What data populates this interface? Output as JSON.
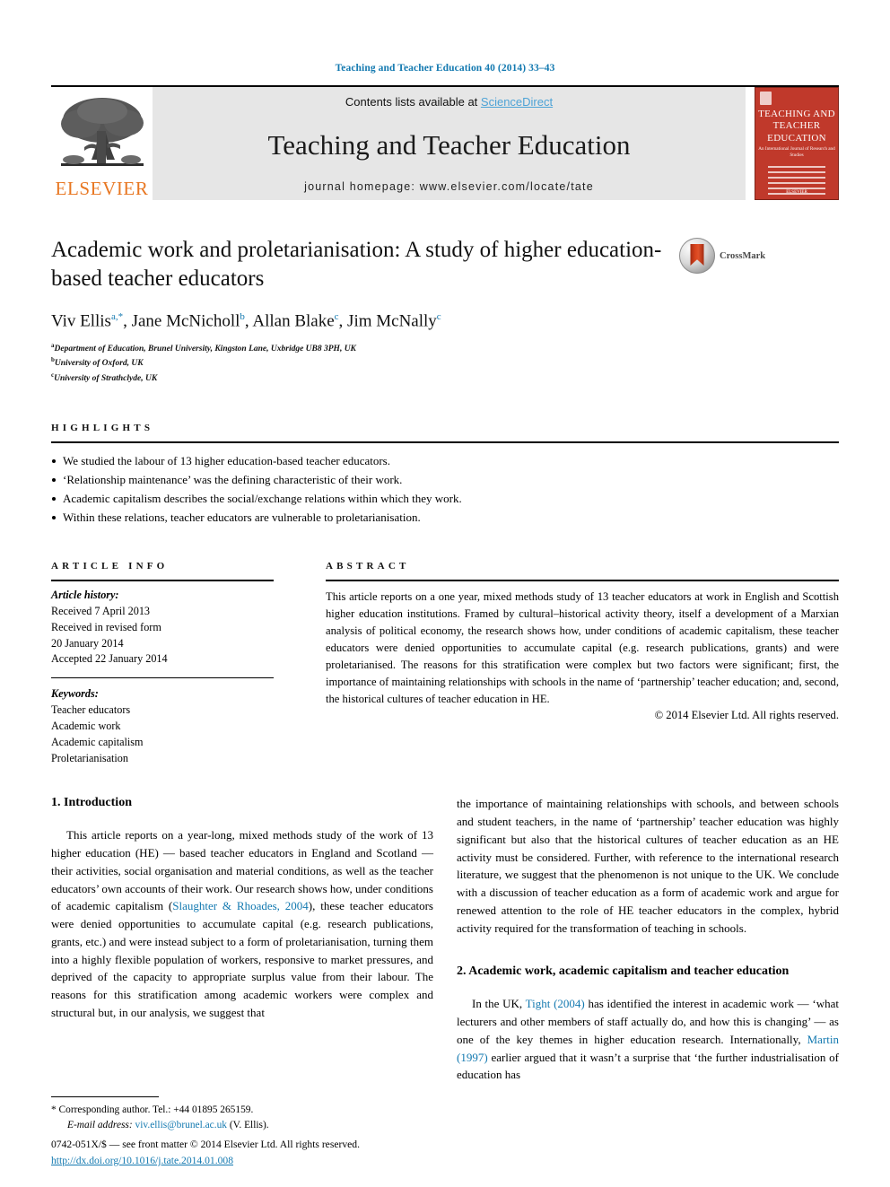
{
  "running_head": "Teaching and Teacher Education 40 (2014) 33–43",
  "masthead": {
    "elsevier_wordmark": "ELSEVIER",
    "contents_prefix": "Contents lists available at ",
    "sciencedirect": "ScienceDirect",
    "journal_title": "Teaching and Teacher Education",
    "homepage": "journal homepage: www.elsevier.com/locate/tate",
    "cover": {
      "title": "TEACHING AND TEACHER EDUCATION",
      "subtitle": "An International Journal of Research and Studies",
      "footer": "ELSEVIER"
    }
  },
  "article": {
    "title": "Academic work and proletarianisation: A study of higher education-based teacher educators",
    "authors_html": "Viv Ellis<sup>a,*</sup>, Jane McNicholl<sup>b</sup>, Allan Blake<sup>c</sup>, Jim McNally<sup>c</sup>",
    "authors_plain": "Viv Ellis, Jane McNicholl, Allan Blake, Jim McNally",
    "affiliations": [
      {
        "mark": "a",
        "text": "Department of Education, Brunel University, Kingston Lane, Uxbridge UB8 3PH, UK"
      },
      {
        "mark": "b",
        "text": "University of Oxford, UK"
      },
      {
        "mark": "c",
        "text": "University of Strathclyde, UK"
      }
    ],
    "crossmark_label": "CrossMark"
  },
  "highlights": {
    "label": "HIGHLIGHTS",
    "items": [
      "We studied the labour of 13 higher education-based teacher educators.",
      "‘Relationship maintenance’ was the defining characteristic of their work.",
      "Academic capitalism describes the social/exchange relations within which they work.",
      "Within these relations, teacher educators are vulnerable to proletarianisation."
    ]
  },
  "article_info": {
    "label": "ARTICLE INFO",
    "history_label": "Article history:",
    "history": [
      "Received 7 April 2013",
      "Received in revised form",
      "20 January 2014",
      "Accepted 22 January 2014"
    ],
    "keywords_label": "Keywords:",
    "keywords": [
      "Teacher educators",
      "Academic work",
      "Academic capitalism",
      "Proletarianisation"
    ]
  },
  "abstract": {
    "label": "ABSTRACT",
    "text": "This article reports on a one year, mixed methods study of 13 teacher educators at work in English and Scottish higher education institutions. Framed by cultural–historical activity theory, itself a development of a Marxian analysis of political economy, the research shows how, under conditions of academic capitalism, these teacher educators were denied opportunities to accumulate capital (e.g. research publications, grants) and were proletarianised. The reasons for this stratification were complex but two factors were significant; first, the importance of maintaining relationships with schools in the name of ‘partnership’ teacher education; and, second, the historical cultures of teacher education in HE.",
    "copyright": "© 2014 Elsevier Ltd. All rights reserved."
  },
  "body": {
    "section1_title": "1. Introduction",
    "para1_a": "This article reports on a year-long, mixed methods study of the work of 13 higher education (HE) — based teacher educators in England and Scotland — their activities, social organisation and material conditions, as well as the teacher educators’ own accounts of their work. Our research shows how, under conditions of academic capitalism (",
    "para1_cite": "Slaughter & Rhoades, 2004",
    "para1_b": "), these teacher educators were denied opportunities to accumulate capital (e.g. research publications, grants, etc.) and were instead subject to a form of proletarianisation, turning them into a highly flexible population of workers, responsive to market pressures, and deprived of the capacity to appropriate surplus value from their labour. The reasons for this stratification among academic workers were complex and structural but, in our analysis, we suggest that",
    "para1_c": "the importance of maintaining relationships with schools, and between schools and student teachers, in the name of ‘partnership’ teacher education was highly significant but also that the historical cultures of teacher education as an HE activity must be considered. Further, with reference to the international research literature, we suggest that the phenomenon is not unique to the UK. We conclude with a discussion of teacher education as a form of academic work and argue for renewed attention to the role of HE teacher educators in the complex, hybrid activity required for the transformation of teaching in schools.",
    "section2_title": "2. Academic work, academic capitalism and teacher education",
    "para2_a": "In the UK, ",
    "para2_cite1": "Tight (2004)",
    "para2_b": " has identified the interest in academic work — ‘what lecturers and other members of staff actually do, and how this is changing’ — as one of the key themes in higher education research. Internationally, ",
    "para2_cite2": "Martin (1997)",
    "para2_c": " earlier argued that it wasn’t a surprise that ‘the further industrialisation of education has"
  },
  "footnote": {
    "corresponding": "* Corresponding author. Tel.: +44 01895 265159.",
    "email_label": "E-mail address:",
    "email": "viv.ellis@brunel.ac.uk",
    "email_owner": "(V. Ellis)."
  },
  "footer": {
    "issn_line": "0742-051X/$ — see front matter © 2014 Elsevier Ltd. All rights reserved.",
    "doi": "http://dx.doi.org/10.1016/j.tate.2014.01.008"
  },
  "colors": {
    "link": "#1379b0",
    "sciencedirect": "#4da3d6",
    "elsevier_orange": "#e87722",
    "cover_red": "#c0392b",
    "banner_gray": "#e6e6e6"
  }
}
